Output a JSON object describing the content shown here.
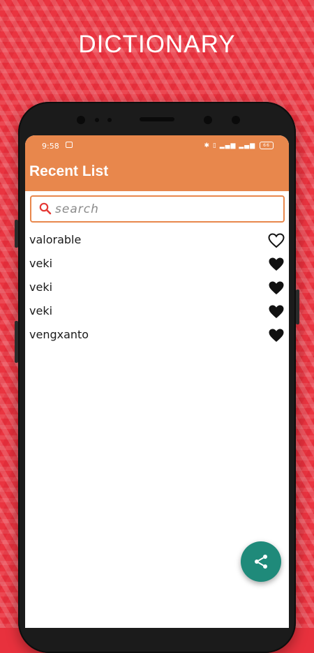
{
  "promo": {
    "headline": "DICTIONARY"
  },
  "status_bar": {
    "time": "9:58",
    "battery": "66"
  },
  "app_bar": {
    "title": "Recent List"
  },
  "search": {
    "placeholder": "search",
    "value": ""
  },
  "recent_words": [
    {
      "word": "valorable",
      "favorite": false
    },
    {
      "word": "veki",
      "favorite": true
    },
    {
      "word": "veki",
      "favorite": true
    },
    {
      "word": "veki",
      "favorite": true
    },
    {
      "word": "vengxanto",
      "favorite": true
    }
  ],
  "fab": {
    "icon": "share-icon",
    "color": "#1f8a7a"
  },
  "colors": {
    "accent": "#e8874c",
    "background": "#ea3440"
  }
}
